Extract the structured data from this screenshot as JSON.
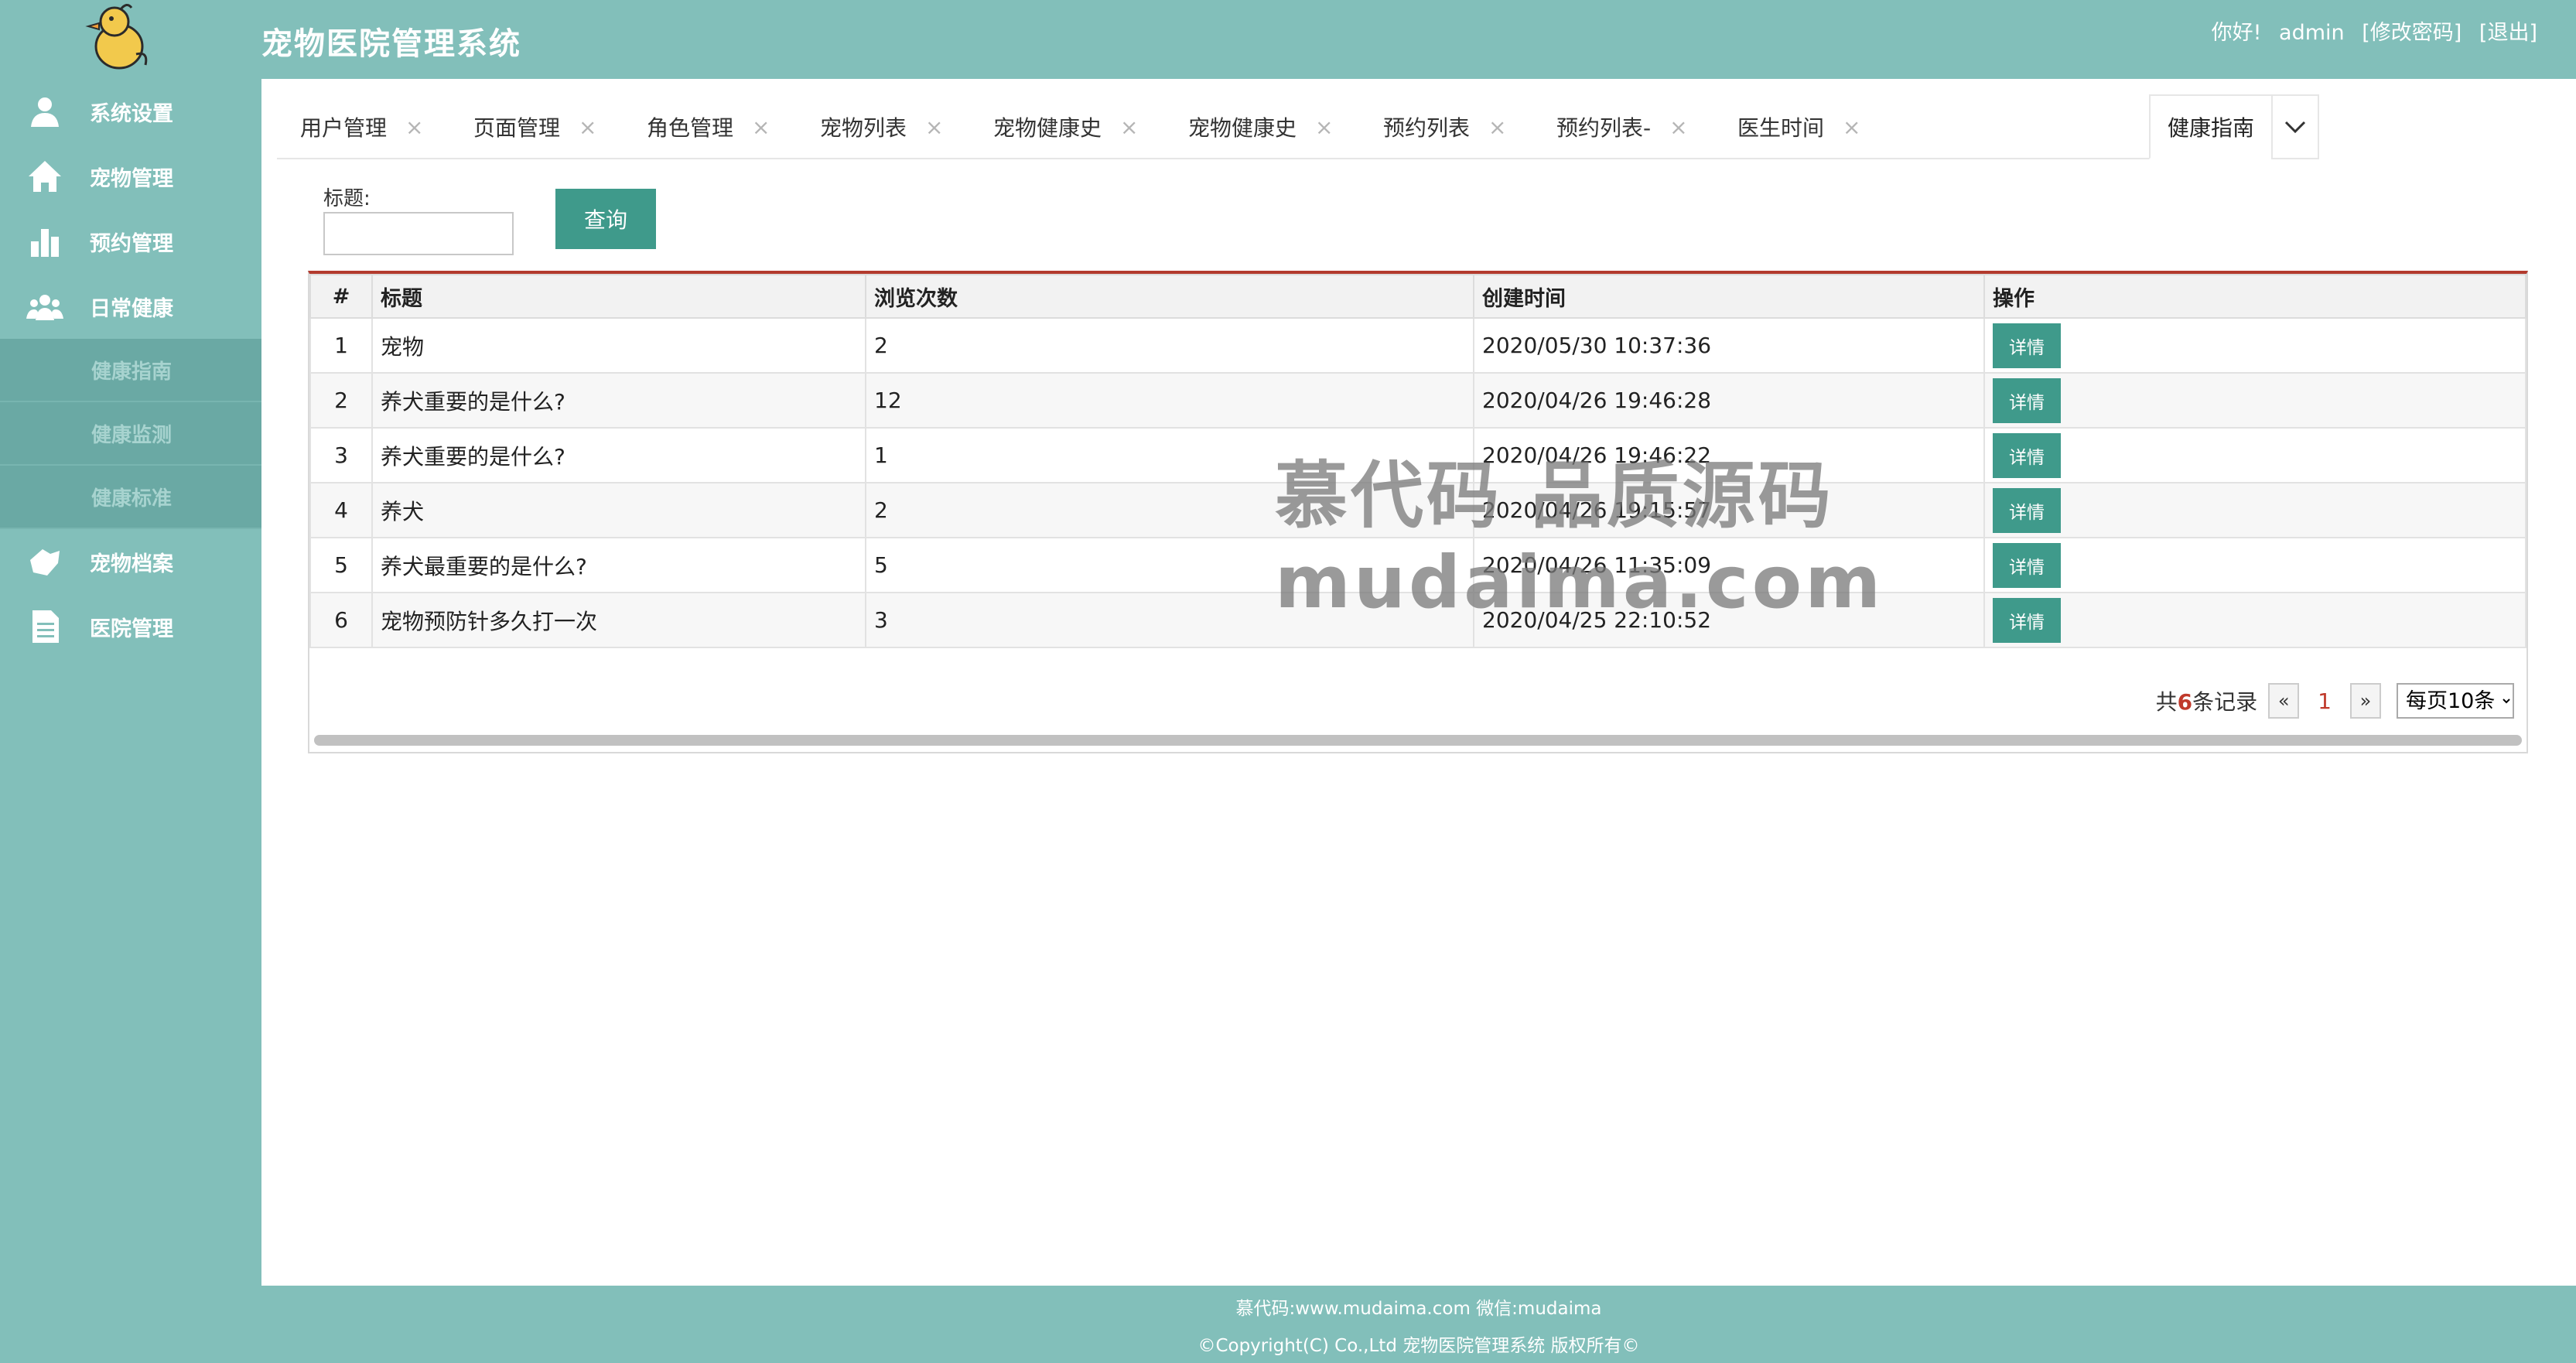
{
  "header": {
    "title": "宠物医院管理系统",
    "greeting": "你好!",
    "username": "admin",
    "change_password": "[修改密码]",
    "logout": "[退出]"
  },
  "sidebar": {
    "items": [
      {
        "label": "系统设置",
        "icon": "user-icon"
      },
      {
        "label": "宠物管理",
        "icon": "home-icon"
      },
      {
        "label": "预约管理",
        "icon": "bar-chart-icon"
      },
      {
        "label": "日常健康",
        "icon": "group-icon"
      }
    ],
    "sub_items": [
      {
        "label": "健康指南"
      },
      {
        "label": "健康监测"
      },
      {
        "label": "健康标准"
      }
    ],
    "items_after": [
      {
        "label": "宠物档案",
        "icon": "archive-icon"
      },
      {
        "label": "医院管理",
        "icon": "document-icon"
      }
    ]
  },
  "tabs": [
    {
      "label": "用户管理"
    },
    {
      "label": "页面管理"
    },
    {
      "label": "角色管理"
    },
    {
      "label": "宠物列表"
    },
    {
      "label": "宠物健康史"
    },
    {
      "label": "宠物健康史"
    },
    {
      "label": "预约列表"
    },
    {
      "label": "预约列表-"
    },
    {
      "label": "医生时间"
    }
  ],
  "active_tab": "健康指南",
  "close_glyph": "×",
  "search": {
    "label": "标题:",
    "value": "",
    "button": "查询"
  },
  "table": {
    "headers": [
      "#",
      "标题",
      "浏览次数",
      "创建时间",
      "操作"
    ],
    "action_label": "详情",
    "rows": [
      {
        "idx": "1",
        "title": "宠物",
        "views": "2",
        "created": "2020/05/30 10:37:36"
      },
      {
        "idx": "2",
        "title": "养犬重要的是什么?",
        "views": "12",
        "created": "2020/04/26 19:46:28"
      },
      {
        "idx": "3",
        "title": "养犬重要的是什么?",
        "views": "1",
        "created": "2020/04/26 19:46:22"
      },
      {
        "idx": "4",
        "title": "养犬",
        "views": "2",
        "created": "2020/04/26 19:15:57"
      },
      {
        "idx": "5",
        "title": "养犬最重要的是什么?",
        "views": "5",
        "created": "2020/04/26 11:35:09"
      },
      {
        "idx": "6",
        "title": "宠物预防针多久打一次",
        "views": "3",
        "created": "2020/04/25 22:10:52"
      }
    ]
  },
  "pagination": {
    "total_prefix": "共",
    "total": "6",
    "total_suffix": "条记录",
    "prev": "«",
    "current": "1",
    "next": "»",
    "page_size": "每页10条"
  },
  "watermark": {
    "line1": "慕代码 品质源码",
    "line2": "mudaima.com"
  },
  "footer": {
    "line1": "慕代码:www.mudaima.com 微信:mudaima",
    "line2": "©Copyright(C) Co.,Ltd 宠物医院管理系统 版权所有©"
  },
  "colors": {
    "theme": "#82bfba",
    "button": "#3f9a8b",
    "table_accent": "#b33a2e"
  }
}
